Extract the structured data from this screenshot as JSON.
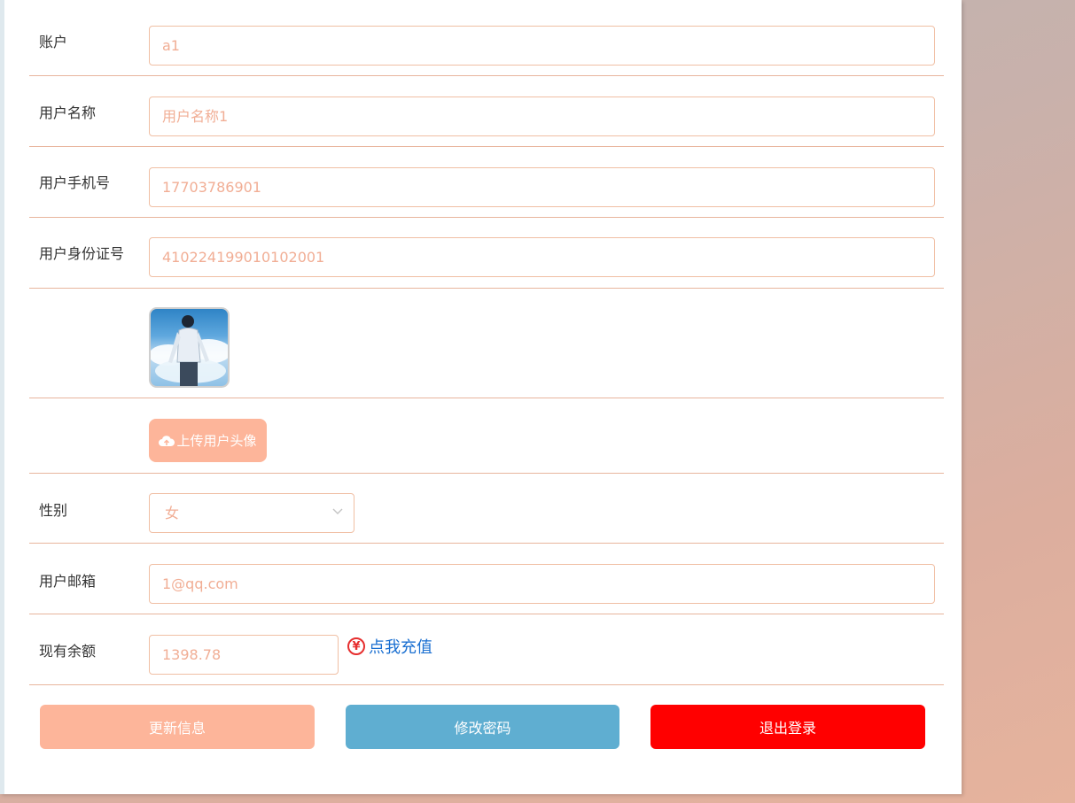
{
  "form": {
    "account": {
      "label": "账户",
      "value": "a1"
    },
    "username": {
      "label": "用户名称",
      "value": "用户名称1"
    },
    "phone": {
      "label": "用户手机号",
      "value": "17703786901"
    },
    "id_number": {
      "label": "用户身份证号",
      "value": "410224199010102001"
    },
    "upload_avatar_label": "上传用户头像",
    "gender": {
      "label": "性别",
      "value": "女"
    },
    "email": {
      "label": "用户邮箱",
      "value": "1@qq.com"
    },
    "balance": {
      "label": "现有余额",
      "value": "1398.78",
      "recharge_label": "点我充值",
      "currency_symbol": "¥"
    }
  },
  "actions": {
    "update_label": "更新信息",
    "change_password_label": "修改密码",
    "logout_label": "退出登录"
  },
  "colors": {
    "accent": "#fdb59a",
    "password_button": "#5faed1",
    "logout_button": "#ff0000",
    "link": "#1a6fd1"
  },
  "icons": {
    "upload": "cloud-upload-icon",
    "recharge": "yen-circle-icon",
    "select": "chevron-down-icon"
  }
}
